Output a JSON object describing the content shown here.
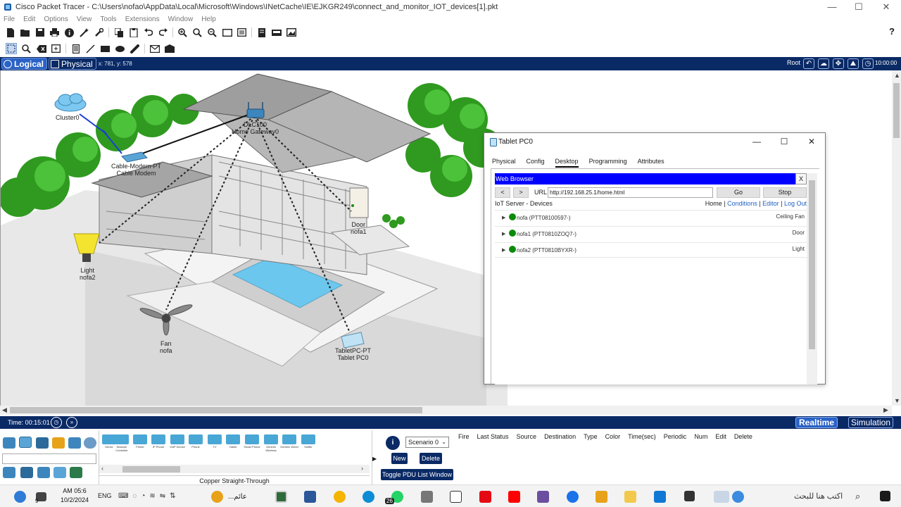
{
  "app": {
    "title": "Cisco Packet Tracer - C:\\Users\\nofao\\AppData\\Local\\Microsoft\\Windows\\INetCache\\IE\\EJKGR249\\connect_and_monitor_IOT_devices[1].pkt",
    "menu": [
      "File",
      "Edit",
      "Options",
      "View",
      "Tools",
      "Extensions",
      "Window",
      "Help"
    ],
    "window_controls": {
      "minimize": "—",
      "maximize": "☐",
      "close": "✕"
    },
    "help_icon": "?"
  },
  "workspace": {
    "logical_label": "Logical",
    "physical_label": "Physical",
    "coords": "x: 781, y: 578",
    "root_label": "Root",
    "clock_label": "10:00:00"
  },
  "canvas": {
    "devices": [
      {
        "line1": "Cluster0",
        "line2": ""
      },
      {
        "line1": "Cable-Modem-PT",
        "line2": "Cable Modem"
      },
      {
        "line1": "DLC100",
        "line2": "Home Gateway0"
      },
      {
        "line1": "Door",
        "line2": "nofa1"
      },
      {
        "line1": "Light",
        "line2": "nofa2"
      },
      {
        "line1": "Fan",
        "line2": "nofa"
      },
      {
        "line1": "TabletPC-PT",
        "line2": "Tablet PC0"
      }
    ]
  },
  "tablet_window": {
    "title": "Tablet PC0",
    "tabs": [
      "Physical",
      "Config",
      "Desktop",
      "Programming",
      "Attributes"
    ],
    "active_tab": "Desktop",
    "browser": {
      "header": "Web Browser",
      "close": "X",
      "back": "<",
      "forward": ">",
      "url_label": "URL",
      "url": "http://192.168.25.1/home.html",
      "go": "Go",
      "stop": "Stop",
      "page_title": "IoT Server - Devices",
      "links": {
        "home": "Home",
        "sep": "|",
        "conditions": "Conditions",
        "editor": "Editor",
        "logout": "Log Out"
      },
      "devices": [
        {
          "name": "nofa (PTT08100597-)",
          "type": "Ceiling Fan",
          "status_color": "#0a8a0a"
        },
        {
          "name": "nofa1 (PTT0810ZOQ7-)",
          "type": "Door",
          "status_color": "#0a8a0a"
        },
        {
          "name": "nofa2 (PTT0810BYXR-)",
          "type": "Light",
          "status_color": "#0a8a0a"
        }
      ]
    }
  },
  "statusbar": {
    "time": "Time: 00:15:01",
    "realtime": "Realtime",
    "simulation": "Simulation"
  },
  "bottom_panel": {
    "device_names": [
      "Server",
      "Network Controller",
      "Printer",
      "IP Phone",
      "VoIP Device",
      "Phone",
      "TV",
      "Tablet",
      "Smart Phone",
      "Generic Wireless",
      "Generic Wired",
      "Sniffer"
    ],
    "cable_label": "Copper Straight-Through",
    "scenario": "Scenario 0",
    "new_button": "New",
    "delete_button": "Delete",
    "toggle_pdu": "Toggle PDU List Window",
    "pdu_columns": [
      "Fire",
      "Last Status",
      "Source",
      "Destination",
      "Type",
      "Color",
      "Time(sec)",
      "Periodic",
      "Num",
      "Edit",
      "Delete"
    ]
  },
  "taskbar": {
    "time": "AM 05:6",
    "date": "10/2/2024",
    "lang": "ENG",
    "app_label": "...عائم",
    "search_placeholder": "اكتب هنا للبحث",
    "badge_count": "26",
    "small_count": "9"
  },
  "colors": {
    "nav_blue": "#0a2a66",
    "accent_blue": "#2a62c6",
    "browser_header": "#0000ff",
    "status_green": "#0a8a0a"
  }
}
